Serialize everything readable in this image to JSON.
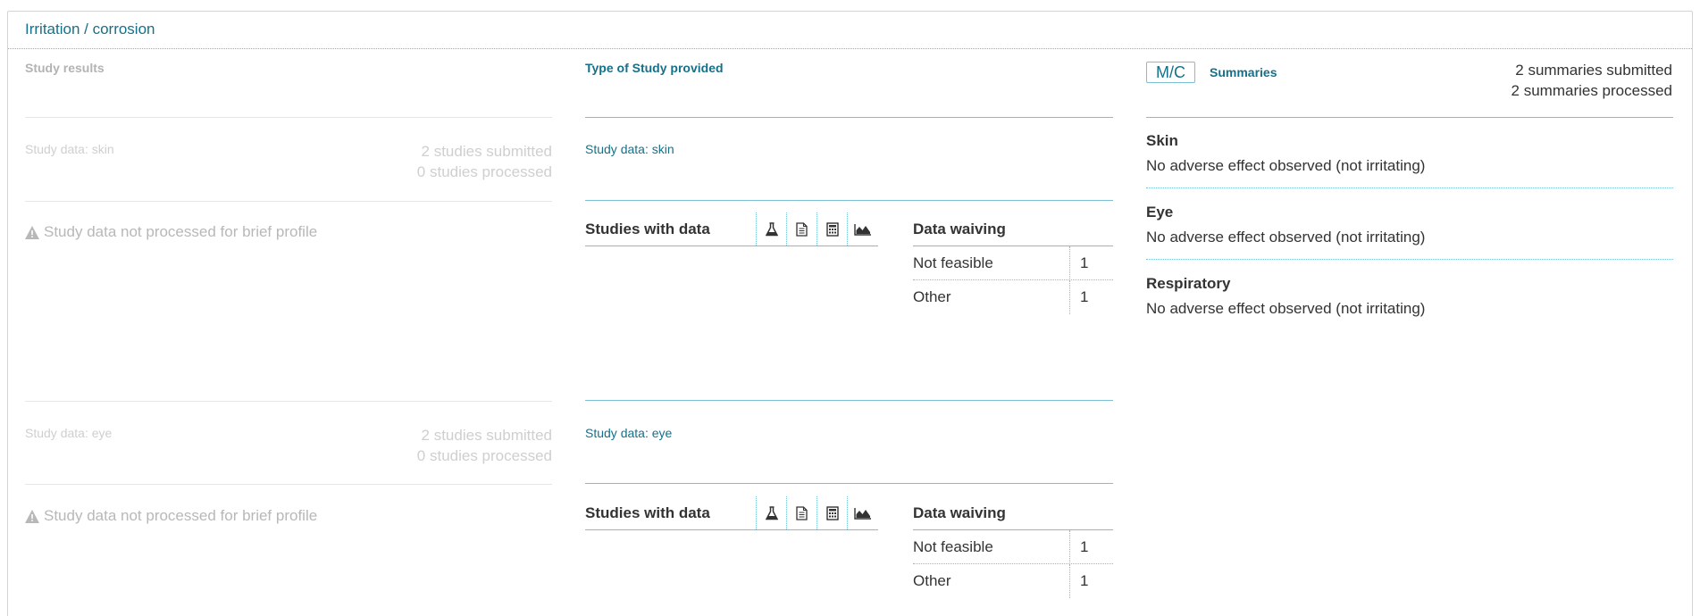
{
  "panel": {
    "title": "Irritation / corrosion"
  },
  "left": {
    "study_results_label": "Study results",
    "sections": [
      {
        "label": "Study data: skin",
        "submitted": "2 studies submitted",
        "processed": "0 studies processed",
        "warning": "Study data not processed for brief profile"
      },
      {
        "label": "Study data: eye",
        "submitted": "2 studies submitted",
        "processed": "0 studies processed",
        "warning": "Study data not processed for brief profile"
      }
    ]
  },
  "middle": {
    "type_label": "Type of Study provided",
    "sections": [
      {
        "label": "Study data: skin",
        "studies_with_data": "Studies with data",
        "data_waiving": "Data waiving",
        "waivers": [
          {
            "name": "Not feasible",
            "count": "1"
          },
          {
            "name": "Other",
            "count": "1"
          }
        ]
      },
      {
        "label": "Study data: eye",
        "studies_with_data": "Studies with data",
        "data_waiving": "Data waiving",
        "waivers": [
          {
            "name": "Not feasible",
            "count": "1"
          },
          {
            "name": "Other",
            "count": "1"
          }
        ]
      }
    ],
    "icons": [
      "flask-icon",
      "document-icon",
      "calculator-icon",
      "area-chart-icon"
    ]
  },
  "right": {
    "badge": "M/C",
    "summaries_label": "Summaries",
    "submitted": "2 summaries submitted",
    "processed": "2 summaries processed",
    "items": [
      {
        "title": "Skin",
        "text": "No adverse effect observed (not irritating)"
      },
      {
        "title": "Eye",
        "text": "No adverse effect observed (not irritating)"
      },
      {
        "title": "Respiratory",
        "text": "No adverse effect observed (not irritating)"
      }
    ]
  },
  "colors": {
    "accent": "#15708a",
    "rule": "#7cc0d4",
    "muted": "#cfcfcf"
  }
}
